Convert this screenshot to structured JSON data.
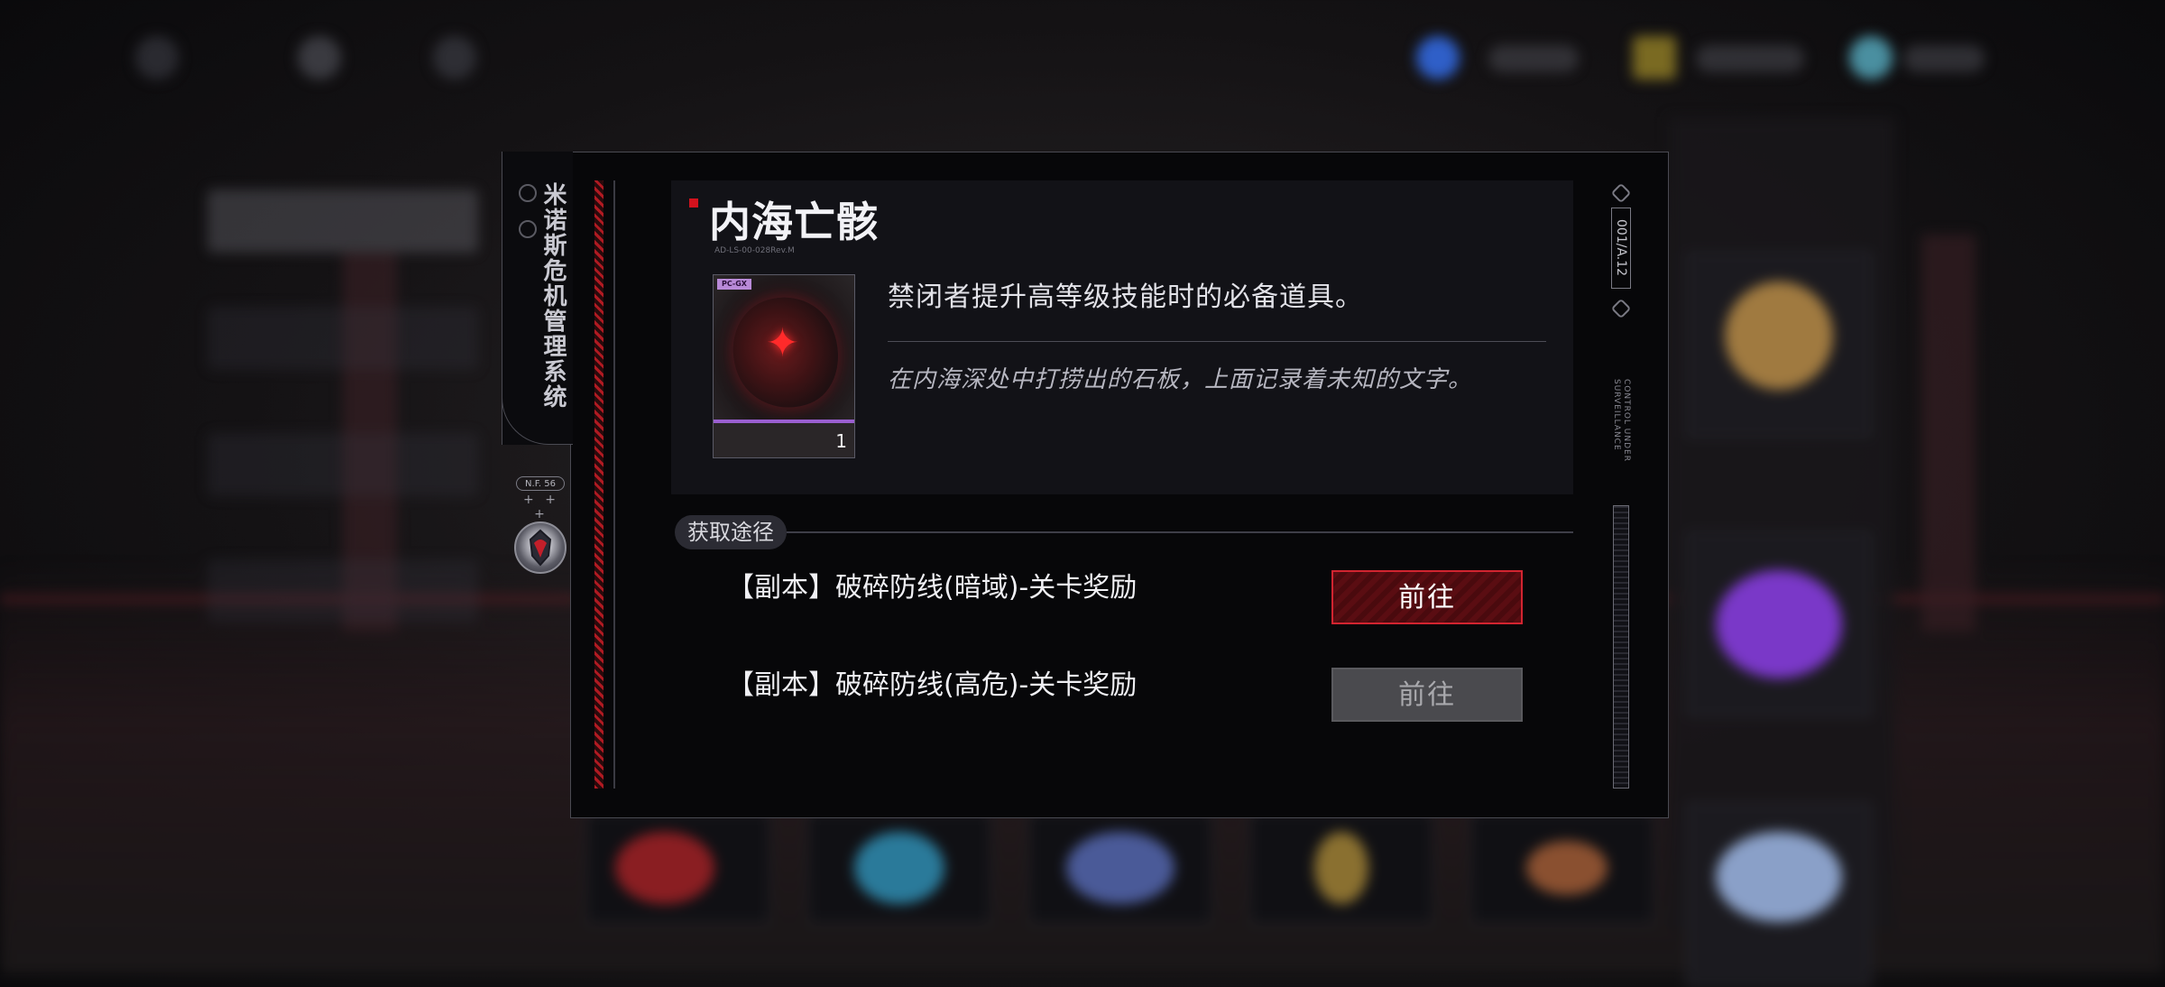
{
  "system": {
    "name": "米诺斯危机管理系统",
    "sub_tag": "N.F. 56",
    "crosses": "+ + +"
  },
  "item": {
    "name": "内海亡骸",
    "code": "AD-LS-00-028Rev.M",
    "tag": "PC-GX",
    "count": "1",
    "description": "禁闭者提升高等级技能时的必备道具。",
    "flavor": "在内海深处中打捞出的石板，上面记录着未知的文字。",
    "rarity_color": "#9a5fd0"
  },
  "sources": {
    "label": "获取途径",
    "routes": [
      {
        "text": "【副本】破碎防线(暗域)-关卡奖励",
        "button": "前往",
        "state": "active"
      },
      {
        "text": "【副本】破碎防线(高危)-关卡奖励",
        "button": "前往",
        "state": "disabled"
      }
    ]
  },
  "rail": {
    "code": "001/A.12",
    "status_text": "CONTROL UNDER SURVEILLANCE"
  },
  "colors": {
    "accent_red": "#d22430",
    "rarity_purple": "#9a5fd0",
    "panel_bg": "#121217"
  }
}
